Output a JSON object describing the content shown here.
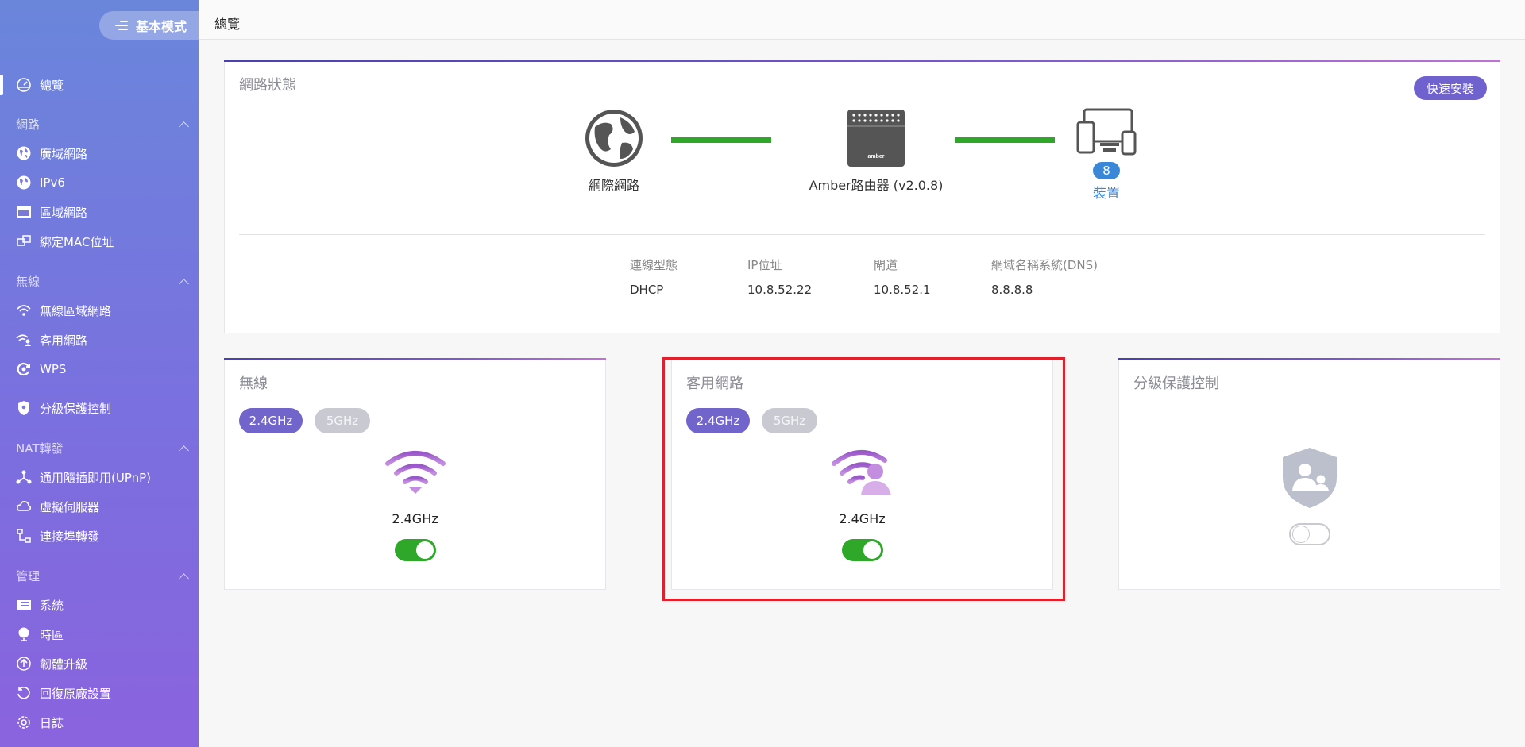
{
  "sidebar": {
    "mode_label": "基本模式",
    "overview": "總覽",
    "groups": {
      "network": "網路",
      "wireless": "無線",
      "nat": "NAT轉發",
      "management": "管理"
    },
    "items": {
      "wan": "廣域網路",
      "ipv6": "IPv6",
      "lan": "區域網路",
      "mac_binding": "綁定MAC位址",
      "wlan": "無線區域網路",
      "guest": "客用網路",
      "wps": "WPS",
      "parental": "分級保護控制",
      "upnp": "通用隨插即用(UPnP)",
      "virtual_server": "虛擬伺服器",
      "port_forward": "連接埠轉發",
      "system": "系統",
      "timezone": "時區",
      "firmware": "韌體升級",
      "factory_reset": "回復原廠設置",
      "log": "日誌"
    }
  },
  "header": {
    "title": "總覽"
  },
  "status": {
    "title": "網路狀態",
    "quick_setup": "快速安裝",
    "internet_label": "網際網路",
    "router_label": "Amber路由器 (v2.0.8)",
    "router_brand": "amber",
    "device_count": "8",
    "devices_label": "裝置",
    "info": {
      "conn_type_label": "連線型態",
      "conn_type": "DHCP",
      "ip_label": "IP位址",
      "ip": "10.8.52.22",
      "gateway_label": "閘道",
      "gateway": "10.8.52.1",
      "dns_label": "網域名稱系統(DNS)",
      "dns": "8.8.8.8"
    }
  },
  "wireless_card": {
    "title": "無線",
    "band_24": "2.4GHz",
    "band_5": "5GHz",
    "active_band": "2.4GHz",
    "enabled": true
  },
  "guest_card": {
    "title": "客用網路",
    "band_24": "2.4GHz",
    "band_5": "5GHz",
    "active_band": "2.4GHz",
    "enabled": true
  },
  "parental_card": {
    "title": "分級保護控制",
    "enabled": false
  },
  "colors": {
    "accent": "#7165cc",
    "link_ok": "#2fa82a",
    "badge": "#3a87d8",
    "highlight": "#e0202a"
  }
}
